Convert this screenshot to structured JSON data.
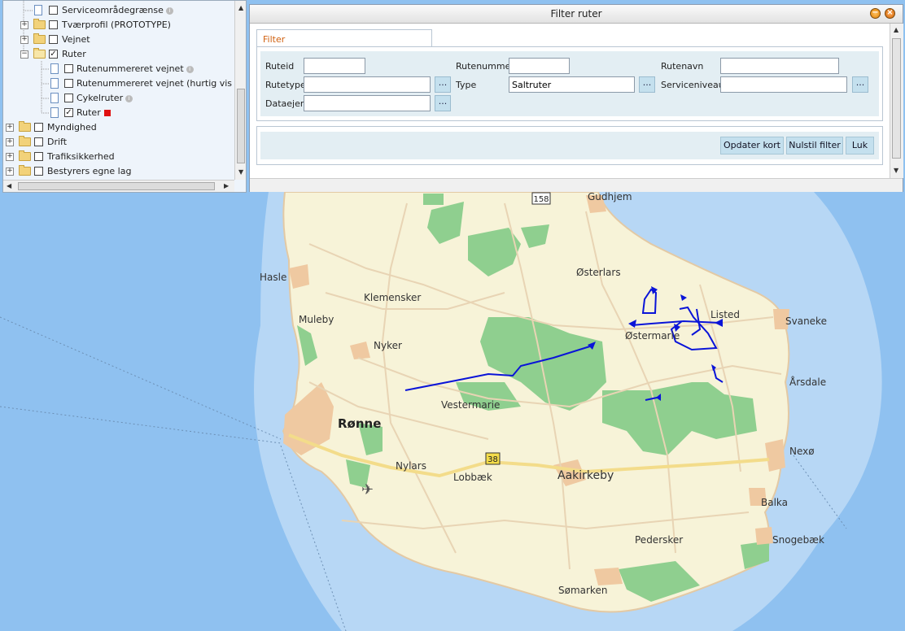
{
  "layer_tree": {
    "items": [
      {
        "label": "Serviceområdegrænse",
        "info": "i"
      },
      {
        "label": "Tværprofil (PROTOTYPE)"
      },
      {
        "label": "Vejnet"
      },
      {
        "label": "Ruter"
      },
      {
        "label": "Rutenummereret vejnet",
        "info": "i"
      },
      {
        "label": "Rutenummereret vejnet (hurtig visning)"
      },
      {
        "label": "Cykelruter",
        "info": "i"
      },
      {
        "label": "Ruter"
      },
      {
        "label": "Myndighed"
      },
      {
        "label": "Drift"
      },
      {
        "label": "Trafiksikkerhed"
      },
      {
        "label": "Bestyrers egne lag"
      }
    ],
    "checked_mark": "✓",
    "active_color": "#e01010"
  },
  "filter_window": {
    "title": "Filter ruter",
    "tab_label": "Filter",
    "fields": {
      "ruteid": {
        "label": "Ruteid",
        "value": ""
      },
      "rutenummer": {
        "label": "Rutenummer",
        "value": ""
      },
      "rutenavn": {
        "label": "Rutenavn",
        "value": ""
      },
      "rutetype": {
        "label": "Rutetype",
        "value": ""
      },
      "type": {
        "label": "Type",
        "value": "Saltruter"
      },
      "serviceniveau": {
        "label": "Serviceniveau",
        "value": ""
      },
      "dataejer": {
        "label": "Dataejer",
        "value": ""
      }
    },
    "browse_label": "...",
    "buttons": {
      "update_map": "Opdater kort",
      "reset_filter": "Nulstil filter",
      "close": "Luk"
    }
  },
  "map": {
    "road_number_158": "158",
    "road_number_38": "38",
    "places": {
      "gudhjem": "Gudhjem",
      "hasle": "Hasle",
      "klemensker": "Klemensker",
      "osterlars": "Østerlars",
      "muleby": "Muleby",
      "listed": "Listed",
      "svaneke": "Svaneke",
      "ostermarie": "Østermarie",
      "nyker": "Nyker",
      "arsdale": "Årsdale",
      "vestermarie": "Vestermarie",
      "ronne": "Rønne",
      "nexo": "Nexø",
      "nylars": "Nylars",
      "lobbaek": "Lobbæk",
      "aakirkeby": "Aakirkeby",
      "balka": "Balka",
      "pedersker": "Pedersker",
      "snogebaek": "Snogebæk",
      "somarken": "Sømarken"
    },
    "route_color": "#0a14d8",
    "sea_color": "#8fc1f0",
    "land_color": "#f7f3d8",
    "forest_color": "#8fcf8f"
  }
}
